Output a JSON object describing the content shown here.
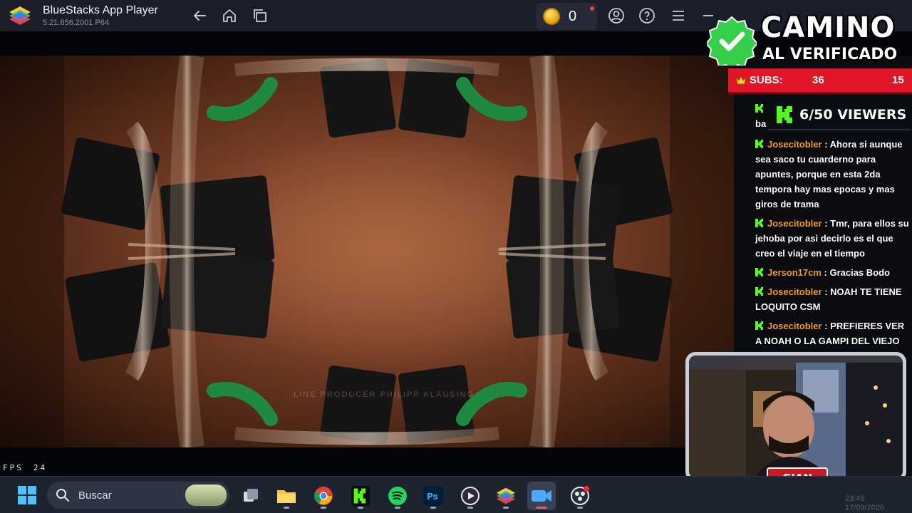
{
  "titlebar": {
    "app_name": "BlueStacks App Player",
    "version": "5.21.656.2001 P64",
    "coin_count": "0",
    "icons": [
      "back-icon",
      "home-icon",
      "multi-instance-icon",
      "coin-icon",
      "account-icon",
      "help-icon",
      "menu-icon",
      "minimize-icon",
      "maximize-icon",
      "close-icon"
    ]
  },
  "video": {
    "credit_line": "LINE PRODUCER PHILIPP KLAUSING",
    "fps_label": "FPS",
    "fps_value": "24"
  },
  "overlay": {
    "title_line1": "CAMINO",
    "title_line2": "AL VERIFICADO",
    "subs_label": "SUBS:",
    "subs_count": "36",
    "subs_goal": "15",
    "viewers": "6/50 VIEWERS",
    "partial_line": "ba",
    "accent_green": "#53fc18",
    "accent_red": "#e01628",
    "username_color": "#f0a018"
  },
  "chat": [
    {
      "user": "Josecitobler",
      "text": "Ahora si aunque sea saco tu cuarderno para apuntes, porque en esta 2da tempora hay mas epocas y mas giros de trama"
    },
    {
      "user": "Josecitobler",
      "text": "Tmr, para ellos su jehoba por asi decirlo es el que creo el viaje en el tiempo"
    },
    {
      "user": "Jerson17cm",
      "text": "Gracias Bodo"
    },
    {
      "user": "Josecitobler",
      "text": "NOAH TE TIENE LOQUITO CSM"
    },
    {
      "user": "Josecitobler",
      "text": "PREFIERES VER A NOAH O LA GAMPI DEL VIEJO"
    }
  ],
  "webcam": {
    "name_tag": "GIAN OVER"
  },
  "taskbar": {
    "search_placeholder": "Buscar",
    "apps": [
      "task-view-icon",
      "file-explorer-icon",
      "chrome-icon",
      "kick-icon",
      "spotify-icon",
      "photoshop-icon",
      "media-player-icon",
      "bluestacks-icon",
      "camera-app-icon",
      "obs-icon"
    ],
    "tray_time": "23:45",
    "tray_date": "17/09/2026"
  }
}
